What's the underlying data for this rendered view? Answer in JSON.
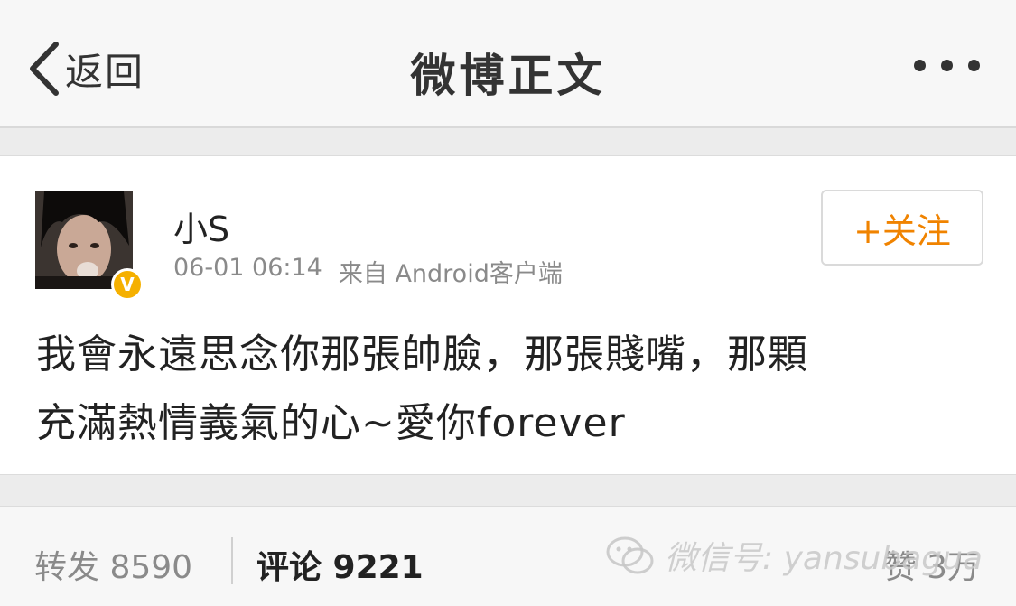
{
  "nav": {
    "back_label": "返回",
    "title": "微博正文"
  },
  "post": {
    "username": "小S",
    "time": "06-01 06:14",
    "source": "来自 Android客户端",
    "follow_label": "+关注",
    "verified_badge": "V",
    "text_line1": "我會永遠思念你那張帥臉，那張賤嘴，那顆",
    "text_line2": "充滿熱情義氣的心~愛你forever"
  },
  "stats": {
    "repost": "转发 8590",
    "comment": "评论 9221",
    "like": "赞 3万"
  },
  "watermark": {
    "text": "微信号: yansubagua"
  },
  "colors": {
    "accent": "#f08300",
    "verified": "#f5b000"
  }
}
